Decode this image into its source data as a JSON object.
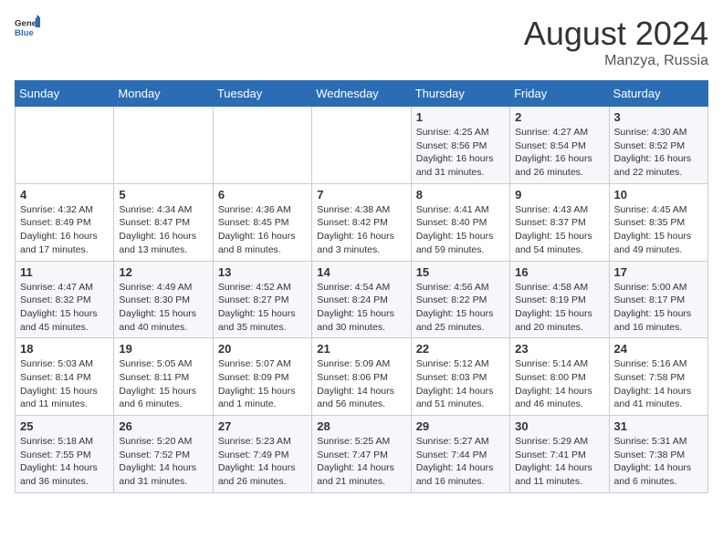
{
  "header": {
    "logo_general": "General",
    "logo_blue": "Blue",
    "month_title": "August 2024",
    "location": "Manzya, Russia"
  },
  "days_of_week": [
    "Sunday",
    "Monday",
    "Tuesday",
    "Wednesday",
    "Thursday",
    "Friday",
    "Saturday"
  ],
  "weeks": [
    [
      {
        "day": "",
        "info": ""
      },
      {
        "day": "",
        "info": ""
      },
      {
        "day": "",
        "info": ""
      },
      {
        "day": "",
        "info": ""
      },
      {
        "day": "1",
        "info": "Sunrise: 4:25 AM\nSunset: 8:56 PM\nDaylight: 16 hours\nand 31 minutes."
      },
      {
        "day": "2",
        "info": "Sunrise: 4:27 AM\nSunset: 8:54 PM\nDaylight: 16 hours\nand 26 minutes."
      },
      {
        "day": "3",
        "info": "Sunrise: 4:30 AM\nSunset: 8:52 PM\nDaylight: 16 hours\nand 22 minutes."
      }
    ],
    [
      {
        "day": "4",
        "info": "Sunrise: 4:32 AM\nSunset: 8:49 PM\nDaylight: 16 hours\nand 17 minutes."
      },
      {
        "day": "5",
        "info": "Sunrise: 4:34 AM\nSunset: 8:47 PM\nDaylight: 16 hours\nand 13 minutes."
      },
      {
        "day": "6",
        "info": "Sunrise: 4:36 AM\nSunset: 8:45 PM\nDaylight: 16 hours\nand 8 minutes."
      },
      {
        "day": "7",
        "info": "Sunrise: 4:38 AM\nSunset: 8:42 PM\nDaylight: 16 hours\nand 3 minutes."
      },
      {
        "day": "8",
        "info": "Sunrise: 4:41 AM\nSunset: 8:40 PM\nDaylight: 15 hours\nand 59 minutes."
      },
      {
        "day": "9",
        "info": "Sunrise: 4:43 AM\nSunset: 8:37 PM\nDaylight: 15 hours\nand 54 minutes."
      },
      {
        "day": "10",
        "info": "Sunrise: 4:45 AM\nSunset: 8:35 PM\nDaylight: 15 hours\nand 49 minutes."
      }
    ],
    [
      {
        "day": "11",
        "info": "Sunrise: 4:47 AM\nSunset: 8:32 PM\nDaylight: 15 hours\nand 45 minutes."
      },
      {
        "day": "12",
        "info": "Sunrise: 4:49 AM\nSunset: 8:30 PM\nDaylight: 15 hours\nand 40 minutes."
      },
      {
        "day": "13",
        "info": "Sunrise: 4:52 AM\nSunset: 8:27 PM\nDaylight: 15 hours\nand 35 minutes."
      },
      {
        "day": "14",
        "info": "Sunrise: 4:54 AM\nSunset: 8:24 PM\nDaylight: 15 hours\nand 30 minutes."
      },
      {
        "day": "15",
        "info": "Sunrise: 4:56 AM\nSunset: 8:22 PM\nDaylight: 15 hours\nand 25 minutes."
      },
      {
        "day": "16",
        "info": "Sunrise: 4:58 AM\nSunset: 8:19 PM\nDaylight: 15 hours\nand 20 minutes."
      },
      {
        "day": "17",
        "info": "Sunrise: 5:00 AM\nSunset: 8:17 PM\nDaylight: 15 hours\nand 16 minutes."
      }
    ],
    [
      {
        "day": "18",
        "info": "Sunrise: 5:03 AM\nSunset: 8:14 PM\nDaylight: 15 hours\nand 11 minutes."
      },
      {
        "day": "19",
        "info": "Sunrise: 5:05 AM\nSunset: 8:11 PM\nDaylight: 15 hours\nand 6 minutes."
      },
      {
        "day": "20",
        "info": "Sunrise: 5:07 AM\nSunset: 8:09 PM\nDaylight: 15 hours\nand 1 minute."
      },
      {
        "day": "21",
        "info": "Sunrise: 5:09 AM\nSunset: 8:06 PM\nDaylight: 14 hours\nand 56 minutes."
      },
      {
        "day": "22",
        "info": "Sunrise: 5:12 AM\nSunset: 8:03 PM\nDaylight: 14 hours\nand 51 minutes."
      },
      {
        "day": "23",
        "info": "Sunrise: 5:14 AM\nSunset: 8:00 PM\nDaylight: 14 hours\nand 46 minutes."
      },
      {
        "day": "24",
        "info": "Sunrise: 5:16 AM\nSunset: 7:58 PM\nDaylight: 14 hours\nand 41 minutes."
      }
    ],
    [
      {
        "day": "25",
        "info": "Sunrise: 5:18 AM\nSunset: 7:55 PM\nDaylight: 14 hours\nand 36 minutes."
      },
      {
        "day": "26",
        "info": "Sunrise: 5:20 AM\nSunset: 7:52 PM\nDaylight: 14 hours\nand 31 minutes."
      },
      {
        "day": "27",
        "info": "Sunrise: 5:23 AM\nSunset: 7:49 PM\nDaylight: 14 hours\nand 26 minutes."
      },
      {
        "day": "28",
        "info": "Sunrise: 5:25 AM\nSunset: 7:47 PM\nDaylight: 14 hours\nand 21 minutes."
      },
      {
        "day": "29",
        "info": "Sunrise: 5:27 AM\nSunset: 7:44 PM\nDaylight: 14 hours\nand 16 minutes."
      },
      {
        "day": "30",
        "info": "Sunrise: 5:29 AM\nSunset: 7:41 PM\nDaylight: 14 hours\nand 11 minutes."
      },
      {
        "day": "31",
        "info": "Sunrise: 5:31 AM\nSunset: 7:38 PM\nDaylight: 14 hours\nand 6 minutes."
      }
    ]
  ]
}
